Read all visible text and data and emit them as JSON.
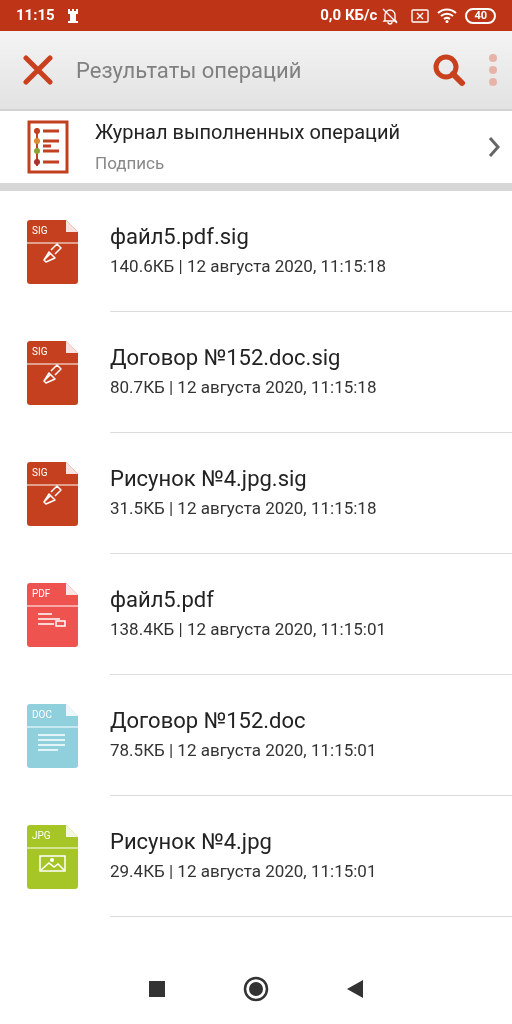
{
  "status_bar": {
    "time": "11:15",
    "net_speed": "0,0 КБ/с",
    "battery": "40"
  },
  "toolbar": {
    "title": "Результаты операций"
  },
  "journal": {
    "title": "Журнал выполненных операций",
    "subtitle": "Подпись"
  },
  "files": [
    {
      "kind": "sig",
      "badge": "SIG",
      "name": "файл5.pdf.sig",
      "meta": "140.6КБ | 12 августа 2020, 11:15:18"
    },
    {
      "kind": "sig",
      "badge": "SIG",
      "name": "Договор №152.doc.sig",
      "meta": "80.7КБ | 12 августа 2020, 11:15:18"
    },
    {
      "kind": "sig",
      "badge": "SIG",
      "name": "Рисунок №4.jpg.sig",
      "meta": "31.5КБ | 12 августа 2020, 11:15:18"
    },
    {
      "kind": "pdf",
      "badge": "PDF",
      "name": "файл5.pdf",
      "meta": "138.4КБ | 12 августа 2020, 11:15:01"
    },
    {
      "kind": "doc",
      "badge": "DOC",
      "name": "Договор №152.doc",
      "meta": "78.5КБ | 12 августа 2020, 11:15:01"
    },
    {
      "kind": "jpg",
      "badge": "JPG",
      "name": "Рисунок №4.jpg",
      "meta": "29.4КБ | 12 августа 2020, 11:15:01"
    }
  ]
}
